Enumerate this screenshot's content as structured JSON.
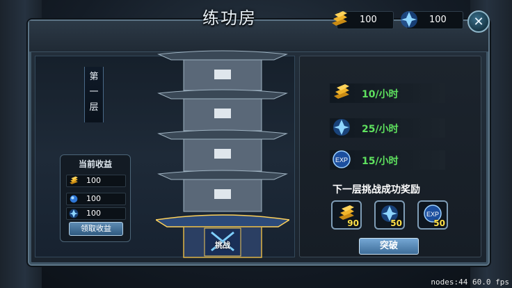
{
  "title": "练功房",
  "resources": [
    {
      "icon": "gold-bars-icon",
      "value": "100"
    },
    {
      "icon": "blue-crystal-icon",
      "value": "100"
    }
  ],
  "floor_label": [
    "第",
    "一",
    "层"
  ],
  "earnings": {
    "title": "当前收益",
    "rows": [
      {
        "icon": "gold-bars-icon",
        "value": "100"
      },
      {
        "icon": "blue-orb-icon",
        "value": "100"
      },
      {
        "icon": "blue-crystal-icon",
        "value": "100"
      }
    ],
    "claim_label": "领取收益"
  },
  "tower": {
    "challenge_label": "挑战"
  },
  "rates": [
    {
      "icon": "gold-bars-icon",
      "text": "10/小时"
    },
    {
      "icon": "blue-crystal-icon",
      "text": "25/小时"
    },
    {
      "icon": "exp-icon",
      "text": "15/小时",
      "icon_text": "EXP"
    }
  ],
  "next_floor": {
    "title": "下一层挑战成功奖励",
    "rewards": [
      {
        "icon": "gold-bars-icon",
        "value": "90"
      },
      {
        "icon": "blue-crystal-icon",
        "value": "50"
      },
      {
        "icon": "exp-icon",
        "value": "50",
        "icon_text": "EXP"
      }
    ]
  },
  "break_label": "突破",
  "debug": "nodes:44  60.0 fps",
  "colors": {
    "rate_green": "#5fe25f",
    "reward_yellow": "#ffe14a"
  }
}
